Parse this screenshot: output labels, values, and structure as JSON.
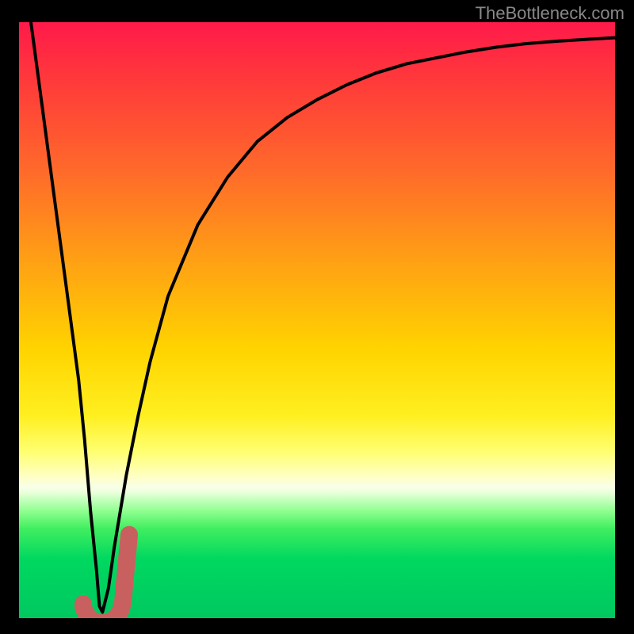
{
  "watermark": "TheBottleneck.com",
  "chart_data": {
    "type": "line",
    "title": "",
    "xlabel": "",
    "ylabel": "",
    "xlim": [
      0,
      100
    ],
    "ylim": [
      0,
      100
    ],
    "series": [
      {
        "name": "bottleneck-curve",
        "x": [
          2,
          4,
          6,
          8,
          10,
          11,
          12,
          13,
          13.5,
          14,
          15,
          16,
          18,
          20,
          22,
          25,
          30,
          35,
          40,
          45,
          50,
          55,
          60,
          65,
          70,
          75,
          80,
          85,
          90,
          95,
          100
        ],
        "values": [
          100,
          85,
          70,
          55,
          40,
          30,
          18,
          8,
          2,
          1,
          5,
          12,
          24,
          34,
          43,
          54,
          66,
          74,
          80,
          84,
          87,
          89.5,
          91.5,
          93,
          94,
          95,
          95.8,
          96.4,
          96.8,
          97.1,
          97.4
        ]
      }
    ],
    "annotations": [
      {
        "name": "highlight-marker",
        "type": "J-shape",
        "x_center": 14.5,
        "y_base": 0,
        "y_top": 14,
        "color": "#c86060"
      }
    ],
    "gradient_stops": [
      {
        "pos": 0,
        "color": "#ff1a4a"
      },
      {
        "pos": 55,
        "color": "#ffd400"
      },
      {
        "pos": 80,
        "color": "#c8ffc0"
      },
      {
        "pos": 100,
        "color": "#00c860"
      }
    ]
  }
}
